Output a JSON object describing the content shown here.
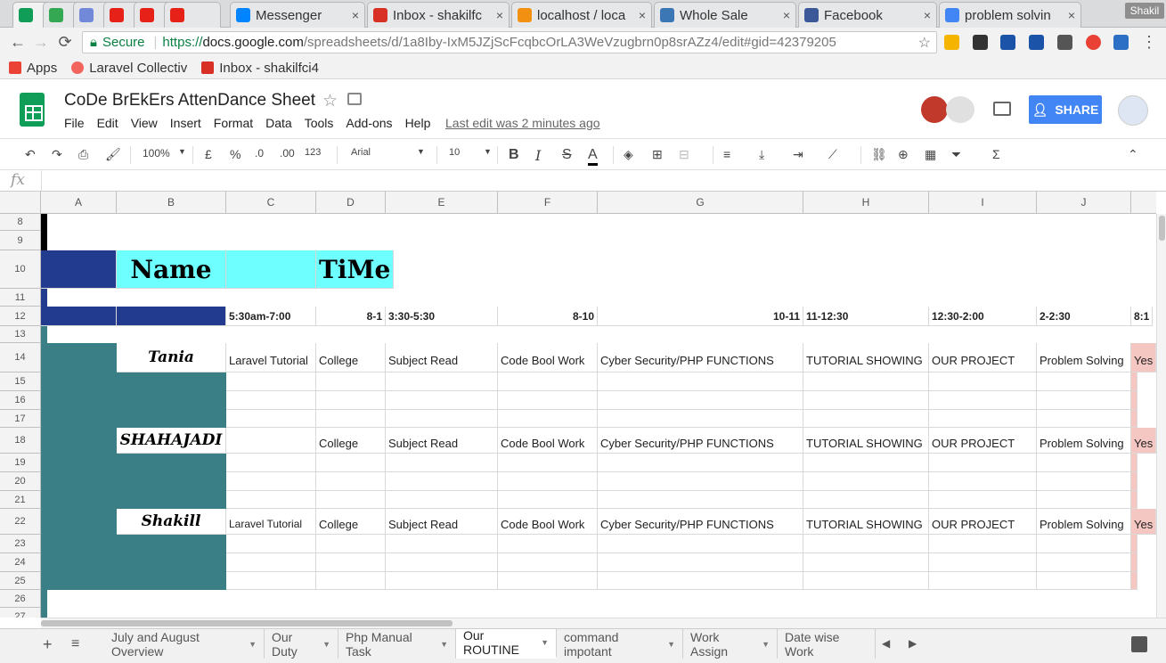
{
  "browser": {
    "tabs": [
      {
        "title": "",
        "color": "#0f9d58"
      },
      {
        "title": "",
        "color": "#34a853"
      },
      {
        "title": "",
        "color": "#7289da"
      },
      {
        "title": "",
        "color": "#e62117"
      },
      {
        "title": "",
        "color": "#e62117"
      },
      {
        "title": "",
        "color": "#e62117"
      },
      {
        "title": "Messenger",
        "color": "#0084ff"
      },
      {
        "title": "Inbox - shakilfc",
        "color": "#d93025"
      },
      {
        "title": "localhost / loca",
        "color": "#f29111"
      },
      {
        "title": "Whole Sale",
        "color": "#3b77b5"
      },
      {
        "title": "Facebook",
        "color": "#3b5998"
      },
      {
        "title": "problem solvin",
        "color": "#4285f4"
      }
    ],
    "user": "Shakil",
    "secure_label": "Secure",
    "url_scheme": "https://",
    "url_host": "docs.google.com",
    "url_path": "/spreadsheets/d/1a8Iby-IxM5JZjScFcqbcOrLA3WeVzugbrn0p8srAZz4/edit#gid=42379205",
    "bookmarks": [
      {
        "label": "Apps",
        "color": "#ea4335"
      },
      {
        "label": "Laravel Collectiv",
        "color": "#f4645f"
      },
      {
        "label": "Inbox - shakilfci4",
        "color": "#d93025"
      }
    ]
  },
  "doc": {
    "title": "CoDe BrEkErs AttenDance Sheet",
    "menus": [
      "File",
      "Edit",
      "View",
      "Insert",
      "Format",
      "Data",
      "Tools",
      "Add-ons",
      "Help"
    ],
    "last_edit": "Last edit was 2 minutes ago",
    "share_label": "SHARE"
  },
  "toolbar": {
    "zoom": "100%",
    "currency": "£",
    "percent": "%",
    "dec_less": ".0",
    "dec_more": ".00",
    "more_formats": "123",
    "font": "Arial",
    "font_size": "10",
    "formula_prefix": "fx"
  },
  "grid": {
    "columns": [
      "A",
      "B",
      "C",
      "D",
      "E",
      "F",
      "G",
      "H",
      "I",
      "J"
    ],
    "row_numbers": [
      "8",
      "9",
      "10",
      "11",
      "12",
      "13",
      "14",
      "15",
      "16",
      "17",
      "18",
      "19",
      "20",
      "21",
      "22",
      "23",
      "24",
      "25",
      "26",
      "27"
    ],
    "header_name": "Name",
    "header_time": "TiMe",
    "time_slots": [
      "5:30am-7:00",
      "8-1",
      "3:30-5:30",
      "8-10",
      "10-11",
      "11-12:30",
      "12:30-2:00",
      "2-2:30",
      "8:1"
    ],
    "colors": {
      "black": "#000000",
      "cyan": "#6effff",
      "navy": "#233b8e",
      "teal": "#3a7e86",
      "pink": "#f4c7c3"
    },
    "people": [
      {
        "name": "Tania",
        "tasks": [
          "Laravel Tutorial",
          "College",
          "Subject Read",
          "Code Bool Work",
          "Cyber Security/PHP FUNCTIONS",
          "TUTORIAL SHOWING",
          "OUR PROJECT",
          "Problem Solving",
          "Yes"
        ]
      },
      {
        "name": "SHAHAJADI",
        "tasks": [
          "",
          "College",
          "Subject Read",
          "Code Bool Work",
          "Cyber Security/PHP FUNCTIONS",
          "TUTORIAL SHOWING",
          "OUR PROJECT",
          "Problem Solving",
          "Yes"
        ]
      },
      {
        "name": "Shakill",
        "tasks": [
          "Laravel Tutorial",
          "College",
          "Subject Read",
          "Code Bool Work",
          "Cyber Security/PHP FUNCTIONS",
          "TUTORIAL SHOWING",
          "OUR PROJECT",
          "Problem Solving",
          "Yes"
        ]
      }
    ]
  },
  "sheets": [
    "July and August Overview",
    "Our Duty",
    "Php Manual Task",
    "Our ROUTINE",
    "command impotant",
    "Work Assign",
    "Date wise Work"
  ],
  "active_sheet": "Our ROUTINE"
}
